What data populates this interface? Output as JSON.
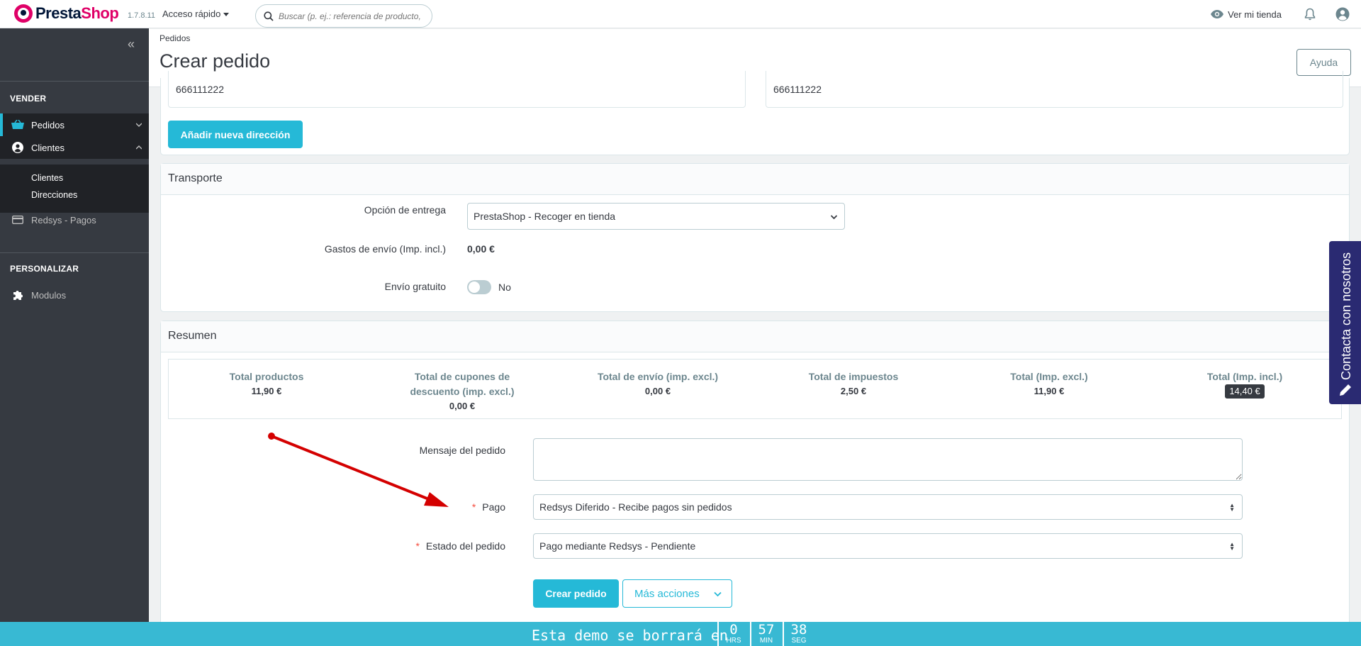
{
  "header": {
    "logo": {
      "presta": "Presta",
      "shop": "Shop"
    },
    "version": "1.7.8.11",
    "quick_access": "Acceso rápido",
    "search_placeholder": "Buscar (p. ej.: referencia de producto,",
    "view_store": "Ver mi tienda"
  },
  "sidebar": {
    "sections": [
      {
        "title": "VENDER"
      },
      {
        "title": "PERSONALIZAR"
      }
    ],
    "items": [
      {
        "label": "Pedidos",
        "icon": "basket-icon"
      },
      {
        "label": "Clientes",
        "icon": "user-circle-icon"
      },
      {
        "label": "Redsys - Pagos",
        "icon": "credit-card-icon"
      },
      {
        "label": "Modulos",
        "icon": "puzzle-icon"
      }
    ],
    "submenu": [
      "Clientes",
      "Direcciones"
    ]
  },
  "page": {
    "breadcrumb": "Pedidos",
    "title": "Crear pedido",
    "help": "Ayuda"
  },
  "addresses": {
    "phone_left": "666111222",
    "phone_right": "666111222",
    "add_button": "Añadir nueva dirección"
  },
  "shipping": {
    "title": "Transporte",
    "delivery_label": "Opción de entrega",
    "delivery_value": "PrestaShop - Recoger en tienda",
    "cost_label": "Gastos de envío (Imp. incl.)",
    "cost_value": "0,00 €",
    "free_label": "Envío gratuito",
    "free_value": "No"
  },
  "summary": {
    "title": "Resumen",
    "totals": [
      {
        "label": "Total productos",
        "value": "11,90 €"
      },
      {
        "label": "Total de cupones de descuento (imp. excl.)",
        "value": "0,00 €"
      },
      {
        "label": "Total de envío (imp. excl.)",
        "value": "0,00 €"
      },
      {
        "label": "Total de impuestos",
        "value": "2,50 €"
      },
      {
        "label": "Total (Imp. excl.)",
        "value": "11,90 €"
      },
      {
        "label": "Total (Imp. incl.)",
        "value": "14,40 €"
      }
    ],
    "message_label": "Mensaje del pedido",
    "payment_label": "Pago",
    "payment_value": "Redsys Diferido - Recibe pagos sin pedidos",
    "status_label": "Estado del pedido",
    "status_value": "Pago mediante Redsys - Pendiente",
    "create_button": "Crear pedido",
    "more_actions": "Más acciones"
  },
  "contact_tab": "Contacta con nosotros",
  "demo_bar": {
    "text": "Esta demo se borrará en",
    "hours": "0",
    "hours_unit": "HRS",
    "minutes": "57",
    "minutes_unit": "MIN",
    "seconds": "38",
    "seconds_unit": "SEG"
  },
  "colors": {
    "primary": "#25b9d7",
    "sidebar": "#363a41",
    "brand": "#df0067",
    "annotation_arrow": "#d40000"
  }
}
